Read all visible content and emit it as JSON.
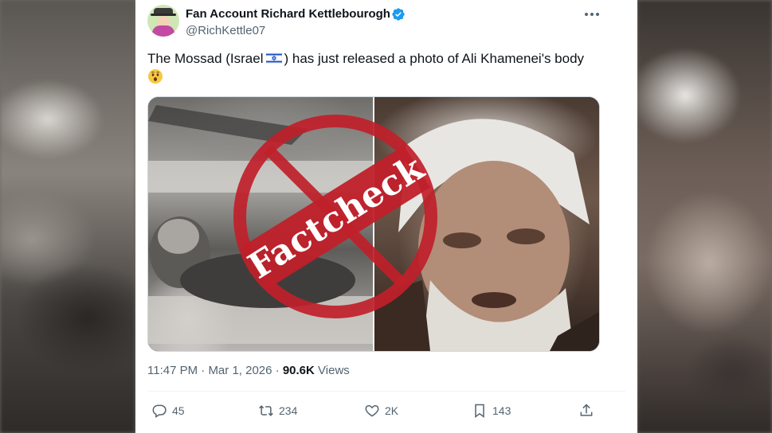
{
  "tweet": {
    "author_name": "Fan Account Richard Kettlebourogh",
    "handle": "@RichKettle07",
    "text_before_flag": "The Mossad (Israel",
    "text_after_flag": ") has just released a photo of Ali Khamenei's body",
    "flag_icon": "israel-flag-icon",
    "emoji_icon": "astonished-face-icon",
    "media": {
      "stamp_text": "Factcheck",
      "stamp_color": "#c0202a"
    },
    "time": "11:47 PM",
    "dot1": "·",
    "date": "Mar 1, 2026",
    "dot2": "·",
    "views_count": "90.6K",
    "views_label": "Views"
  },
  "actions": {
    "replies": "45",
    "reposts": "234",
    "likes": "2K",
    "bookmarks": "143"
  },
  "colors": {
    "verified": "#1d9bf0",
    "text": "#0f1419",
    "secondary": "#536471"
  }
}
